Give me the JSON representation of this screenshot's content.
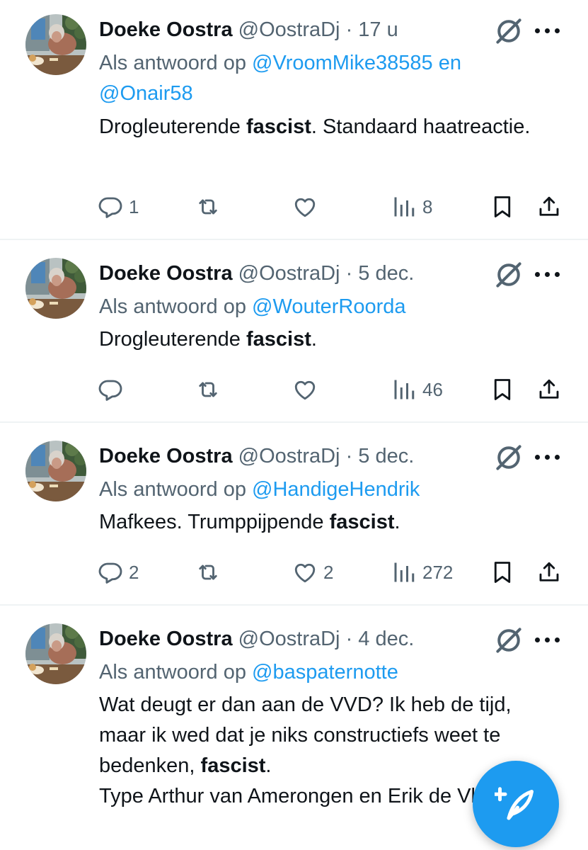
{
  "tweets": [
    {
      "name": "Doeke Oostra",
      "handle": "@OostraDj",
      "dot": "·",
      "time": "17 u",
      "reply_prefix": "Als antwoord op",
      "mention1": "@VroomMike38585",
      "reply_join": "en",
      "mention2": "@Onair58",
      "text1": "Drogleuterende",
      "bold": "fascist",
      "text2": ". Standaard haatreactie.",
      "replies": "1",
      "retweets": "",
      "likes": "",
      "views": "8"
    },
    {
      "name": "Doeke Oostra",
      "handle": "@OostraDj",
      "dot": "·",
      "time": "5 dec.",
      "reply_prefix": "Als antwoord op",
      "mention1": "@WouterRoorda",
      "text1": "Drogleuterende",
      "bold": "fascist",
      "text2": ".",
      "replies": "",
      "retweets": "",
      "likes": "",
      "views": "46"
    },
    {
      "name": "Doeke Oostra",
      "handle": "@OostraDj",
      "dot": "·",
      "time": "5 dec.",
      "reply_prefix": "Als antwoord op",
      "mention1": "@HandigeHendrik",
      "text1": "Mafkees. Trumppijpende",
      "bold": "fascist",
      "text2": ".",
      "replies": "2",
      "retweets": "",
      "likes": "2",
      "views": "272"
    },
    {
      "name": "Doeke Oostra",
      "handle": "@OostraDj",
      "dot": "·",
      "time": "4 dec.",
      "reply_prefix": "Als antwoord op",
      "mention1": "@baspaternotte",
      "text1": "Wat deugt er dan aan de VVD? Ik heb de tijd, maar ik wed dat je niks constructiefs weet te bedenken,",
      "bold": "fascist",
      "text2": ".",
      "text3": "Type Arthur van Amerongen en Erik de Vlieger."
    }
  ],
  "icons": {
    "reply": "reply-icon",
    "retweet": "retweet-icon",
    "like": "heart-icon",
    "views": "views-icon",
    "bookmark": "bookmark-icon",
    "share": "share-icon",
    "grok": "grok-icon",
    "more": "more-icon",
    "compose": "compose-icon"
  },
  "colors": {
    "accent": "#1d9bf0",
    "text": "#0f1419",
    "secondary": "#536471",
    "divider": "#eff3f4"
  }
}
